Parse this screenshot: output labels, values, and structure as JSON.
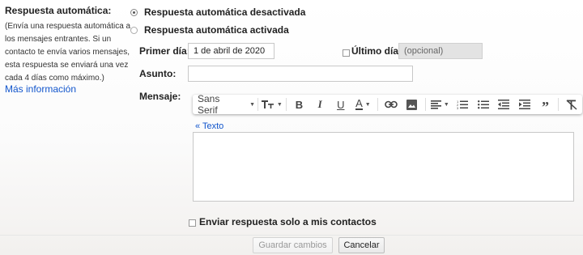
{
  "sidebar": {
    "title": "Respuesta automática:",
    "description": "(Envía una respuesta automática a los mensajes entrantes. Si un contacto te envía varios mensajes, esta respuesta se enviará una vez cada 4 días como máximo.)",
    "more_link": "Más información"
  },
  "options": [
    {
      "label": "Respuesta automática desactivada",
      "selected": true
    },
    {
      "label": "Respuesta automática activada",
      "selected": false
    }
  ],
  "first_day": {
    "label": "Primer día:",
    "value": "1 de abril de 2020"
  },
  "last_day": {
    "label": "Último día:",
    "placeholder": "(opcional)",
    "checked": false
  },
  "subject": {
    "label": "Asunto:",
    "value": ""
  },
  "message": {
    "label": "Mensaje:",
    "toolbar": {
      "font": "Sans Serif",
      "tools": [
        "text-size",
        "bold",
        "italic",
        "underline",
        "text-color",
        "link",
        "image",
        "align",
        "numbered-list",
        "bulleted-list",
        "indent-less",
        "indent-more",
        "quote",
        "remove-formatting"
      ]
    },
    "plain_text_link": "« Texto",
    "body": ""
  },
  "contacts_only": {
    "label": "Enviar respuesta solo a mis contactos",
    "checked": false
  },
  "buttons": {
    "save": "Guardar cambios",
    "cancel": "Cancelar"
  }
}
